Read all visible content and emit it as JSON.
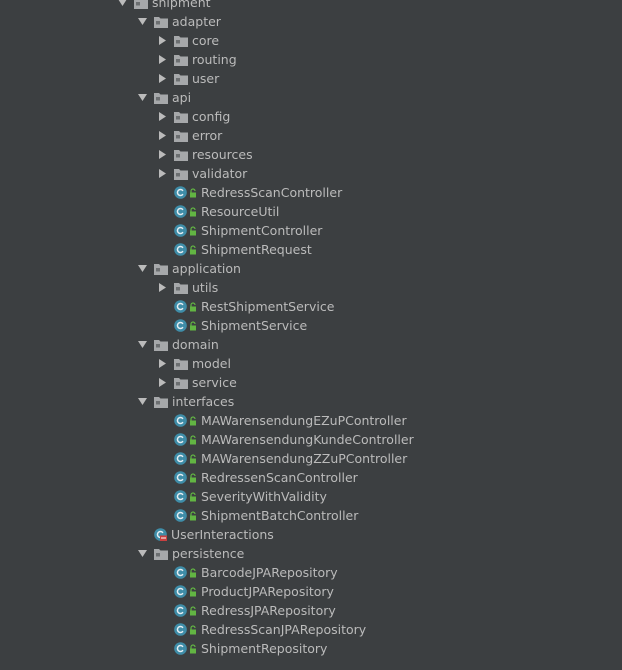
{
  "tree": [
    {
      "label": "shipment",
      "type": "folder",
      "depth": 0,
      "state": "expanded"
    },
    {
      "label": "adapter",
      "type": "folder",
      "depth": 1,
      "state": "expanded"
    },
    {
      "label": "core",
      "type": "folder",
      "depth": 2,
      "state": "collapsed"
    },
    {
      "label": "routing",
      "type": "folder",
      "depth": 2,
      "state": "collapsed"
    },
    {
      "label": "user",
      "type": "folder",
      "depth": 2,
      "state": "collapsed"
    },
    {
      "label": "api",
      "type": "folder",
      "depth": 1,
      "state": "expanded"
    },
    {
      "label": "config",
      "type": "folder",
      "depth": 2,
      "state": "collapsed"
    },
    {
      "label": "error",
      "type": "folder",
      "depth": 2,
      "state": "collapsed"
    },
    {
      "label": "resources",
      "type": "folder",
      "depth": 2,
      "state": "collapsed"
    },
    {
      "label": "validator",
      "type": "folder",
      "depth": 2,
      "state": "collapsed"
    },
    {
      "label": "RedressScanController",
      "type": "class",
      "depth": 2
    },
    {
      "label": "ResourceUtil",
      "type": "class",
      "depth": 2
    },
    {
      "label": "ShipmentController",
      "type": "class",
      "depth": 2
    },
    {
      "label": "ShipmentRequest",
      "type": "class",
      "depth": 2
    },
    {
      "label": "application",
      "type": "folder",
      "depth": 1,
      "state": "expanded"
    },
    {
      "label": "utils",
      "type": "folder",
      "depth": 2,
      "state": "collapsed"
    },
    {
      "label": "RestShipmentService",
      "type": "class",
      "depth": 2
    },
    {
      "label": "ShipmentService",
      "type": "class",
      "depth": 2
    },
    {
      "label": "domain",
      "type": "folder",
      "depth": 1,
      "state": "expanded"
    },
    {
      "label": "model",
      "type": "folder",
      "depth": 2,
      "state": "collapsed"
    },
    {
      "label": "service",
      "type": "folder",
      "depth": 2,
      "state": "collapsed"
    },
    {
      "label": "interfaces",
      "type": "folder",
      "depth": 1,
      "state": "expanded"
    },
    {
      "label": "MAWarensendungEZuPController",
      "type": "class",
      "depth": 2
    },
    {
      "label": "MAWarensendungKundeController",
      "type": "class",
      "depth": 2
    },
    {
      "label": "MAWarensendungZZuPController",
      "type": "class",
      "depth": 2
    },
    {
      "label": "RedressenScanController",
      "type": "class",
      "depth": 2
    },
    {
      "label": "SeverityWithValidity",
      "type": "class",
      "depth": 2
    },
    {
      "label": "ShipmentBatchController",
      "type": "class",
      "depth": 2
    },
    {
      "label": "UserInteractions",
      "type": "class-error",
      "depth": 1
    },
    {
      "label": "persistence",
      "type": "folder",
      "depth": 1,
      "state": "expanded"
    },
    {
      "label": "BarcodeJPARepository",
      "type": "class",
      "depth": 2
    },
    {
      "label": "ProductJPARepository",
      "type": "class",
      "depth": 2
    },
    {
      "label": "RedressJPARepository",
      "type": "class",
      "depth": 2
    },
    {
      "label": "RedressScanJPARepository",
      "type": "class",
      "depth": 2
    },
    {
      "label": "ShipmentRepository",
      "type": "class",
      "depth": 2
    }
  ],
  "colors": {
    "background": "#3c3f41",
    "text": "#bbbbbb",
    "arrow": "#bbbbbb",
    "folder": "#a6a8aa",
    "class_icon": "#3f8da8",
    "lock_icon": "#62b543",
    "error_mark": "#c84040"
  },
  "icons": {
    "expanded": "triangle-down-icon",
    "collapsed": "triangle-right-icon",
    "folder": "package-folder-icon",
    "class": "java-class-icon",
    "access": "lock-icon",
    "error": "error-stripe-icon"
  }
}
